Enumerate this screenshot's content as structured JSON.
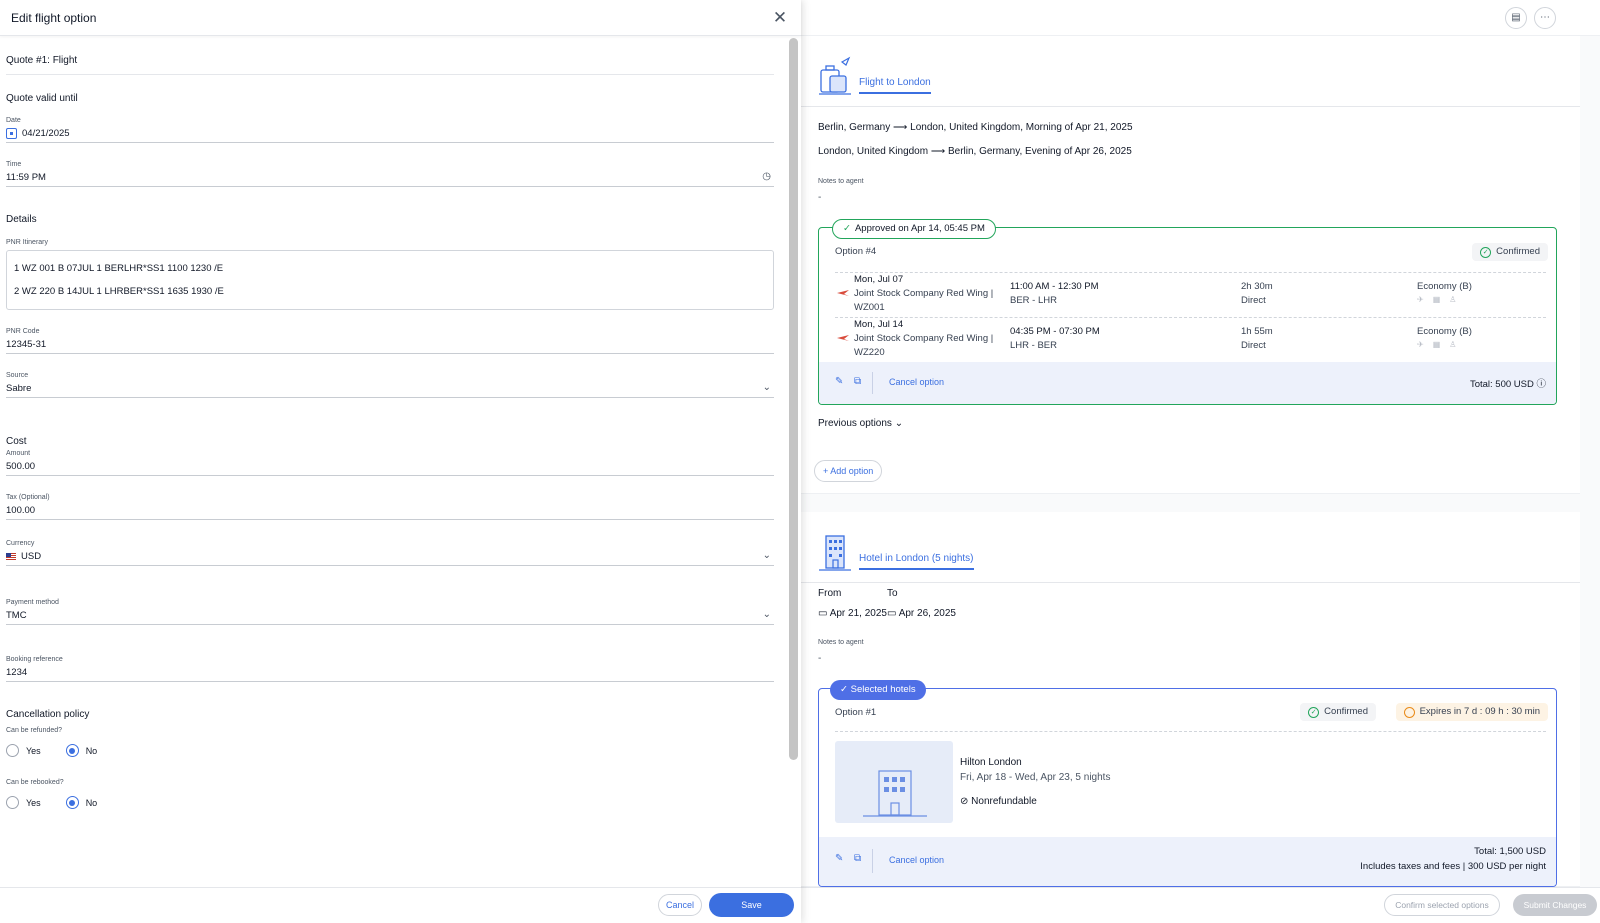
{
  "drawer": {
    "title": "Edit flight option",
    "quote_title": "Quote #1: Flight",
    "quote_valid": {
      "heading": "Quote valid until",
      "date_label": "Date",
      "date_value": "04/21/2025",
      "time_label": "Time",
      "time_value": "11:59 PM"
    },
    "details": {
      "heading": "Details",
      "pnr_label": "PNR Itinerary",
      "pnr_lines": [
        "1 WZ 001 B 07JUL 1 BERLHR*SS1  1100 1230 /E",
        "2 WZ 220 B 14JUL 1 LHRBER*SS1  1635 1930  /E"
      ],
      "pnr_code_label": "PNR Code",
      "pnr_code_value": "12345-31",
      "source_label": "Source",
      "source_value": "Sabre"
    },
    "cost": {
      "heading": "Cost",
      "amount_label": "Amount",
      "amount_value": "500.00",
      "tax_label": "Tax (Optional)",
      "tax_value": "100.00",
      "currency_label": "Currency",
      "currency_value": "USD",
      "payment_label": "Payment method",
      "payment_value": "TMC",
      "booking_label": "Booking reference",
      "booking_value": "1234"
    },
    "cancellation": {
      "heading": "Cancellation policy",
      "refund_label": "Can be refunded?",
      "rebook_label": "Can be rebooked?",
      "yes_label": "Yes",
      "no_label": "No",
      "refund_selected": "No",
      "rebook_selected": "No"
    },
    "footer": {
      "cancel_label": "Cancel",
      "save_label": "Save"
    }
  },
  "right": {
    "flight": {
      "tab_label": "Flight to London",
      "routes": [
        "Berlin, Germany ⟶ London, United Kingdom, Morning of Apr 21, 2025",
        "London, United Kingdom ⟶ Berlin, Germany, Evening of Apr 26, 2025"
      ],
      "notes_label": "Notes to agent",
      "notes_value": "-",
      "option": {
        "approved_badge": "Approved on Apr 14, 05:45 PM",
        "title": "Option #4",
        "status": "Confirmed",
        "segments": [
          {
            "date": "Mon, Jul 07",
            "airline": "Joint Stock Company Red Wing |",
            "flight_no": "WZ001",
            "times": "11:00 AM - 12:30 PM",
            "route": "BER - LHR",
            "duration": "2h 30m",
            "stops": "Direct",
            "cabin": "Economy (B)"
          },
          {
            "date": "Mon, Jul 14",
            "airline": "Joint Stock Company Red Wing |",
            "flight_no": "WZ220",
            "times": "04:35 PM - 07:30 PM",
            "route": "LHR - BER",
            "duration": "1h 55m",
            "stops": "Direct",
            "cabin": "Economy (B)"
          }
        ],
        "cancel_label": "Cancel option",
        "total": "Total: 500 USD"
      },
      "previous_options": "Previous options",
      "add_option": "Add option"
    },
    "hotel": {
      "tab_label": "Hotel in London (5 nights)",
      "from_label": "From",
      "to_label": "To",
      "from_value": "Apr 21, 2025",
      "to_value": "Apr 26, 2025",
      "notes_label": "Notes to agent",
      "notes_value": "-",
      "option": {
        "badge": "Selected hotels",
        "title": "Option #1",
        "status": "Confirmed",
        "expires": "Expires in 7 d : 09 h : 30 min",
        "hotel_name": "Hilton London",
        "hotel_dates": "Fri, Apr 18 - Wed, Apr 23, 5 nights",
        "refund": "Nonrefundable",
        "cancel_label": "Cancel option",
        "total": "Total: 1,500 USD",
        "total_sub": "Includes taxes and fees | 300 USD per night"
      }
    },
    "bottom": {
      "confirm_label": "Confirm selected options",
      "submit_label": "Submit Changes"
    }
  },
  "colors": {
    "accent": "#3b6fe0",
    "approved": "#22a55b",
    "selected": "#4f6fe6",
    "expires": "#e98b1a"
  }
}
